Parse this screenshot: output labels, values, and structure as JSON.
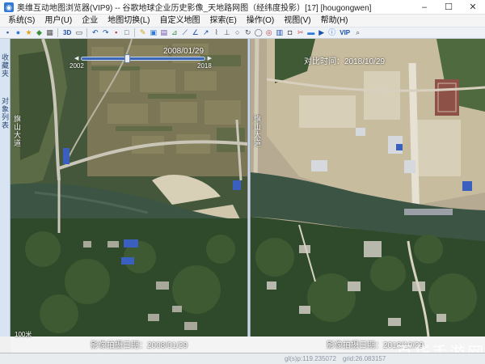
{
  "window": {
    "title": "奥维互动地图浏览器(VIP9) -- 谷歌地球企业历史影像_天地路网图（经纬度投影）[17] [hougongwen]",
    "app_icon": "globe-icon",
    "minimize": "–",
    "maximize": "☐",
    "close": "✕"
  },
  "menu": {
    "items": [
      "系统(S)",
      "用户(U)",
      "企业",
      "地图切换(L)",
      "自定义地图",
      "探索(E)",
      "操作(O)",
      "视图(V)",
      "帮助(H)"
    ]
  },
  "toolbar": {
    "label_3d": "3D",
    "label_vip": "VIP"
  },
  "sidebar": {
    "top_label": "收藏夹",
    "bottom_label": "对象列表"
  },
  "left_map": {
    "timeline_date": "2008/01/29",
    "timeline_start": "2002",
    "timeline_end": "2018",
    "road_label": "旗山大道",
    "capture_label": "影像拍摄日期：2008/01/29",
    "scale": "100米"
  },
  "right_map": {
    "compare_label": "对比时间：2018/10/29",
    "road_label": "旗山大道",
    "capture_label": "影像拍摄日期：2018/10/29"
  },
  "status": {
    "left": "gl(s)p:119.235072",
    "right": "grid:26.083157"
  },
  "watermark": "百华手游网",
  "colors": {
    "map_green_dark": "#2f4a2a",
    "map_field": "#7a7a52",
    "river": "#3c5444",
    "road": "#c9c6b8",
    "timeline": "#3c67b4"
  }
}
